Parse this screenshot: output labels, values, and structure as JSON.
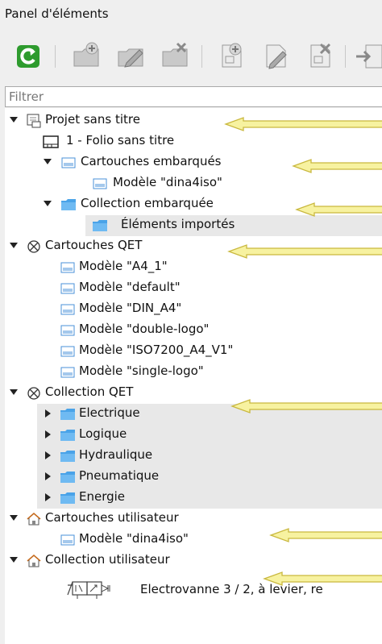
{
  "panel": {
    "title": "Panel d'éléments"
  },
  "toolbar": {
    "buttons": [
      {
        "name": "reload-button",
        "icon": "reload-icon"
      },
      {
        "name": "new-folder-button",
        "icon": "new-folder-icon"
      },
      {
        "name": "edit-folder-button",
        "icon": "edit-folder-icon"
      },
      {
        "name": "delete-folder-button",
        "icon": "delete-folder-icon"
      },
      {
        "name": "new-element-button",
        "icon": "new-element-icon"
      },
      {
        "name": "edit-element-button",
        "icon": "edit-element-icon"
      },
      {
        "name": "delete-element-button",
        "icon": "delete-element-icon"
      },
      {
        "name": "import-button",
        "icon": "import-icon"
      }
    ]
  },
  "filter": {
    "placeholder": "Filtrer",
    "value": ""
  },
  "tree": [
    {
      "label": "Projet sans titre",
      "icon": "project-icon",
      "expanded": true
    },
    {
      "label": "1 - Folio sans titre",
      "icon": "folio-icon"
    },
    {
      "label": "Cartouches embarqués",
      "icon": "titleblock-collection-icon",
      "expanded": true
    },
    {
      "label": "Modèle \"dina4iso\"",
      "icon": "titleblock-icon"
    },
    {
      "label": "Collection embarquée",
      "icon": "folder-icon",
      "expanded": true
    },
    {
      "label": "Éléments importés",
      "icon": "folder-icon"
    },
    {
      "label": "Cartouches QET",
      "icon": "qet-collection-icon",
      "expanded": true
    },
    {
      "label": "Modèle \"A4_1\"",
      "icon": "titleblock-icon"
    },
    {
      "label": "Modèle \"default\"",
      "icon": "titleblock-icon"
    },
    {
      "label": "Modèle \"DIN_A4\"",
      "icon": "titleblock-icon"
    },
    {
      "label": "Modèle \"double-logo\"",
      "icon": "titleblock-icon"
    },
    {
      "label": "Modèle \"ISO7200_A4_V1\"",
      "icon": "titleblock-icon"
    },
    {
      "label": "Modèle \"single-logo\"",
      "icon": "titleblock-icon"
    },
    {
      "label": "Collection QET",
      "icon": "qet-collection-icon",
      "expanded": true
    },
    {
      "label": "Electrique",
      "icon": "folder-icon",
      "expanded": false
    },
    {
      "label": "Logique",
      "icon": "folder-icon",
      "expanded": false
    },
    {
      "label": "Hydraulique",
      "icon": "folder-icon",
      "expanded": false
    },
    {
      "label": "Pneumatique",
      "icon": "folder-icon",
      "expanded": false
    },
    {
      "label": "Energie",
      "icon": "folder-icon",
      "expanded": false
    },
    {
      "label": "Cartouches utilisateur",
      "icon": "home-icon",
      "expanded": true
    },
    {
      "label": "Modèle \"dina4iso\"",
      "icon": "titleblock-icon"
    },
    {
      "label": "Collection utilisateur",
      "icon": "home-icon",
      "expanded": true
    },
    {
      "label": "Electrovanne 3 / 2, à levier, re",
      "icon": "valve-symbol-icon"
    }
  ],
  "colors": {
    "highlight_arrow": "#f7f2a0",
    "arrow_outline": "#c9b83e",
    "folder_blue": "#4aa3e8",
    "reload_green": "#2e9b2e"
  }
}
